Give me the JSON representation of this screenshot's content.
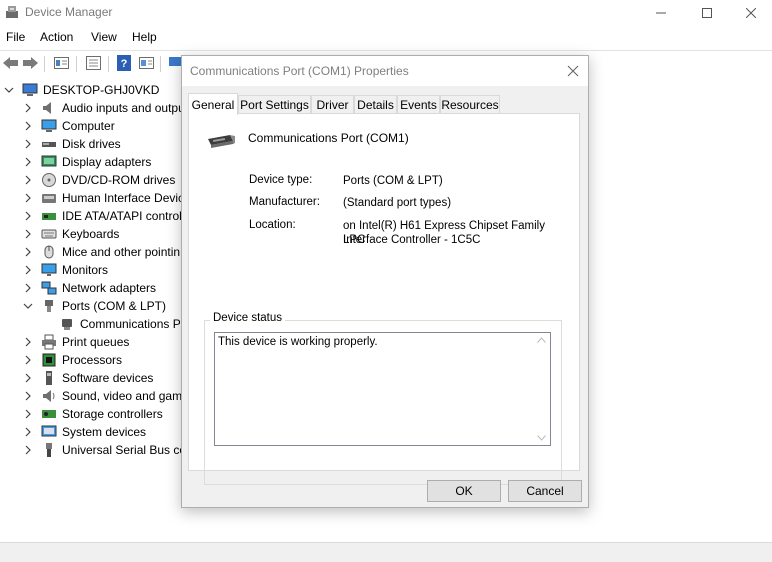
{
  "window": {
    "title": "Device Manager",
    "minimize_icon": "minimize-icon",
    "maximize_icon": "maximize-icon",
    "close_icon": "close-icon"
  },
  "menu": [
    "File",
    "Action",
    "View",
    "Help"
  ],
  "tree": {
    "root": "DESKTOP-GHJ0VKD",
    "items": [
      {
        "label": "Audio inputs and outpu",
        "icon": "speaker-icon",
        "expanded": false
      },
      {
        "label": "Computer",
        "icon": "computer-icon",
        "expanded": false
      },
      {
        "label": "Disk drives",
        "icon": "disk-drive-icon",
        "expanded": false
      },
      {
        "label": "Display adapters",
        "icon": "display-adapter-icon",
        "expanded": false
      },
      {
        "label": "DVD/CD-ROM drives",
        "icon": "dvd-drive-icon",
        "expanded": false
      },
      {
        "label": "Human Interface Devic",
        "icon": "hid-icon",
        "expanded": false
      },
      {
        "label": "IDE ATA/ATAPI controll",
        "icon": "ide-controller-icon",
        "expanded": false
      },
      {
        "label": "Keyboards",
        "icon": "keyboard-icon",
        "expanded": false
      },
      {
        "label": "Mice and other pointin",
        "icon": "mouse-icon",
        "expanded": false
      },
      {
        "label": "Monitors",
        "icon": "monitor-icon",
        "expanded": false
      },
      {
        "label": "Network adapters",
        "icon": "network-adapter-icon",
        "expanded": false
      },
      {
        "label": "Ports (COM & LPT)",
        "icon": "port-icon",
        "expanded": true
      },
      {
        "label": "Communications P",
        "icon": "port-icon",
        "child": true
      },
      {
        "label": "Print queues",
        "icon": "printer-icon",
        "expanded": false
      },
      {
        "label": "Processors",
        "icon": "processor-icon",
        "expanded": false
      },
      {
        "label": "Software devices",
        "icon": "software-device-icon",
        "expanded": false
      },
      {
        "label": "Sound, video and game",
        "icon": "sound-icon",
        "expanded": false
      },
      {
        "label": "Storage controllers",
        "icon": "storage-controller-icon",
        "expanded": false
      },
      {
        "label": "System devices",
        "icon": "system-device-icon",
        "expanded": false
      },
      {
        "label": "Universal Serial Bus cor",
        "icon": "usb-icon",
        "expanded": false
      }
    ]
  },
  "dialog": {
    "title": "Communications Port (COM1) Properties",
    "tabs": [
      "General",
      "Port Settings",
      "Driver",
      "Details",
      "Events",
      "Resources"
    ],
    "active_tab": "General",
    "device_name": "Communications Port (COM1)",
    "properties": {
      "device_type_label": "Device type:",
      "device_type_value": "Ports (COM & LPT)",
      "manufacturer_label": "Manufacturer:",
      "manufacturer_value": "(Standard port types)",
      "location_label": "Location:",
      "location_value_line1": "on Intel(R) H61 Express Chipset Family LPC",
      "location_value_line2": "Interface Controller - 1C5C"
    },
    "status_group_label": "Device status",
    "status_text": "This device is working properly.",
    "ok_label": "OK",
    "cancel_label": "Cancel"
  },
  "colors": {
    "accent": "#0078d7",
    "dialog_bg": "#f0f0f0",
    "button_bg": "#e1e1e1",
    "title_text_gray": "#808080"
  }
}
